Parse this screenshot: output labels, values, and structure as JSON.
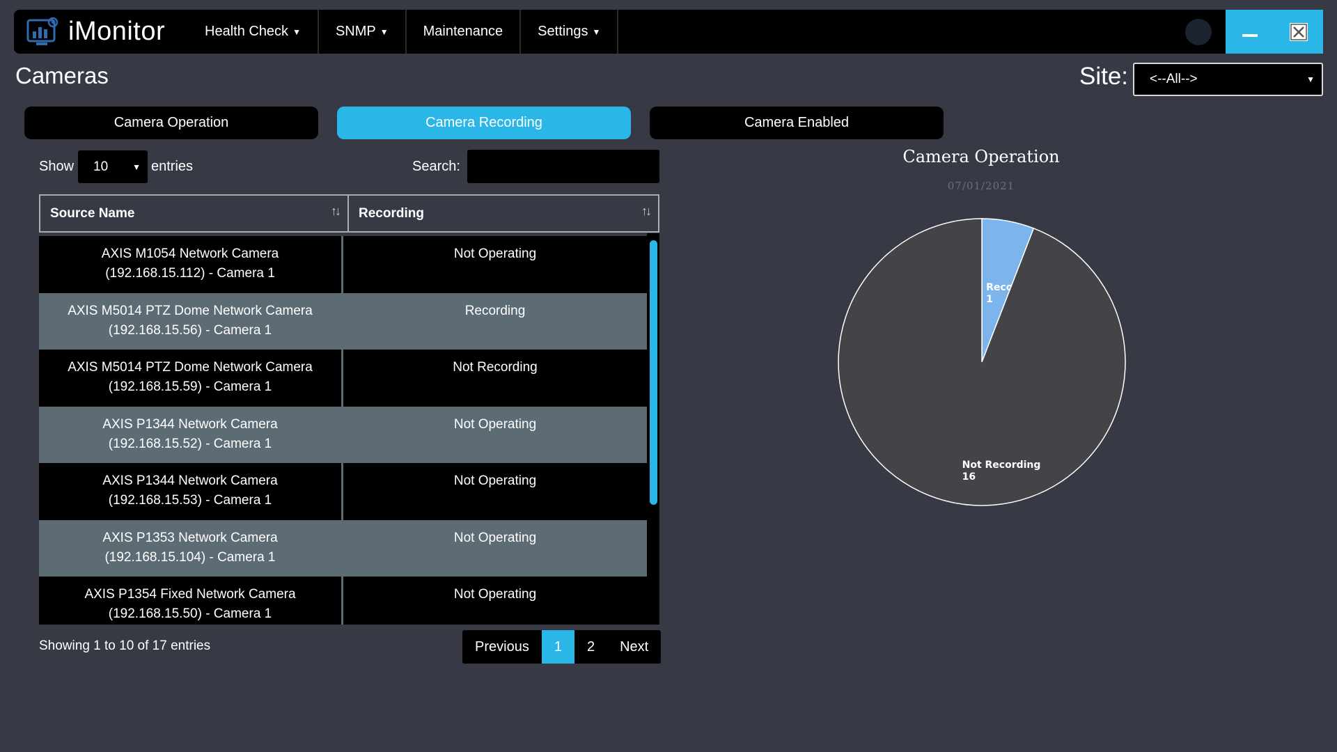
{
  "app": {
    "name": "iMonitor",
    "menu": [
      {
        "label": "Health Check",
        "has_dropdown": true
      },
      {
        "label": "SNMP",
        "has_dropdown": true
      },
      {
        "label": "Maintenance",
        "has_dropdown": false
      },
      {
        "label": "Settings",
        "has_dropdown": true
      }
    ],
    "theme_icon": "moon-icon",
    "window_controls": [
      "minimize-icon",
      "close-icon"
    ]
  },
  "page": {
    "title": "Cameras",
    "site_label": "Site:",
    "site_value": "<--All-->"
  },
  "tabs": [
    {
      "label": "Camera Operation",
      "active": false
    },
    {
      "label": "Camera Recording",
      "active": true
    },
    {
      "label": "Camera Enabled",
      "active": false
    }
  ],
  "table_controls": {
    "show_label": "Show",
    "page_length": "10",
    "entries_label": "entries",
    "search_label": "Search:",
    "search_value": ""
  },
  "table": {
    "columns": [
      "Source Name",
      "Recording"
    ],
    "rows": [
      {
        "name_line1": "AXIS M1054 Network Camera",
        "name_line2": "(192.168.15.112) - Camera 1",
        "status": "Not Operating"
      },
      {
        "name_line1": "AXIS M5014 PTZ Dome Network Camera",
        "name_line2": "(192.168.15.56) - Camera 1",
        "status": "Recording"
      },
      {
        "name_line1": "AXIS M5014 PTZ Dome Network Camera",
        "name_line2": "(192.168.15.59) - Camera 1",
        "status": "Not Recording"
      },
      {
        "name_line1": "AXIS P1344 Network Camera",
        "name_line2": "(192.168.15.52) - Camera 1",
        "status": "Not Operating"
      },
      {
        "name_line1": "AXIS P1344 Network Camera",
        "name_line2": "(192.168.15.53) - Camera 1",
        "status": "Not Operating"
      },
      {
        "name_line1": "AXIS P1353 Network Camera",
        "name_line2": "(192.168.15.104) - Camera 1",
        "status": "Not Operating"
      },
      {
        "name_line1": "AXIS P1354 Fixed Network Camera",
        "name_line2": "(192.168.15.50) - Camera 1",
        "status": "Not Operating"
      }
    ],
    "info": "Showing 1 to 10 of 17 entries"
  },
  "pagination": {
    "previous": "Previous",
    "pages": [
      "1",
      "2"
    ],
    "current": "1",
    "next": "Next"
  },
  "colors": {
    "accent": "#2bb6e8",
    "background": "#373a45",
    "row_alt": "#5d6b74",
    "slice_recording": "#7cb5ec",
    "slice_not_recording": "#434348"
  },
  "chart_data": {
    "type": "pie",
    "title": "Camera Operation",
    "subtitle": "07/01/2021",
    "slices": [
      {
        "label": "Recording",
        "value": 1
      },
      {
        "label": "Not Recording",
        "value": 16
      }
    ]
  }
}
